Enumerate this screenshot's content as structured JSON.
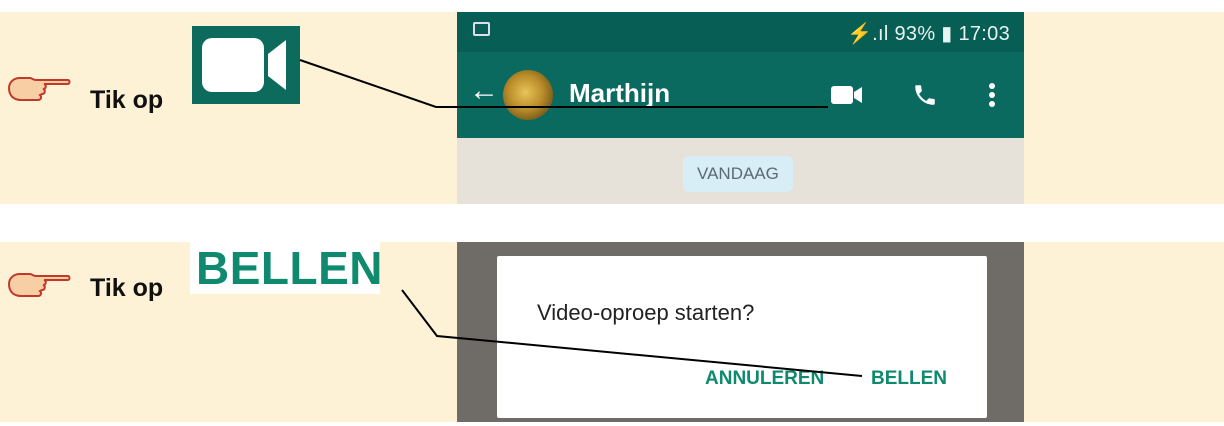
{
  "step1": {
    "instruction": "Tik op",
    "phone": {
      "status_right": "⚡.ıl 93% ▮ 17:03",
      "contact_name": "Marthijn",
      "date_chip": "VANDAAG"
    }
  },
  "step2": {
    "instruction": "Tik op",
    "callout_text": "BELLEN",
    "dialog": {
      "title": "Video-oproep starten?",
      "cancel_label": "ANNULEREN",
      "confirm_label": "BELLEN"
    }
  },
  "colors": {
    "panel_bg": "#fdf2d6",
    "whatsapp_dark": "#075e54",
    "whatsapp_green": "#0f8a6f"
  },
  "icons": {
    "hand": "pointing-hand-icon",
    "video": "video-camera-icon",
    "phone": "phone-icon",
    "menu": "more-vert-icon",
    "back": "arrow-left-icon"
  }
}
